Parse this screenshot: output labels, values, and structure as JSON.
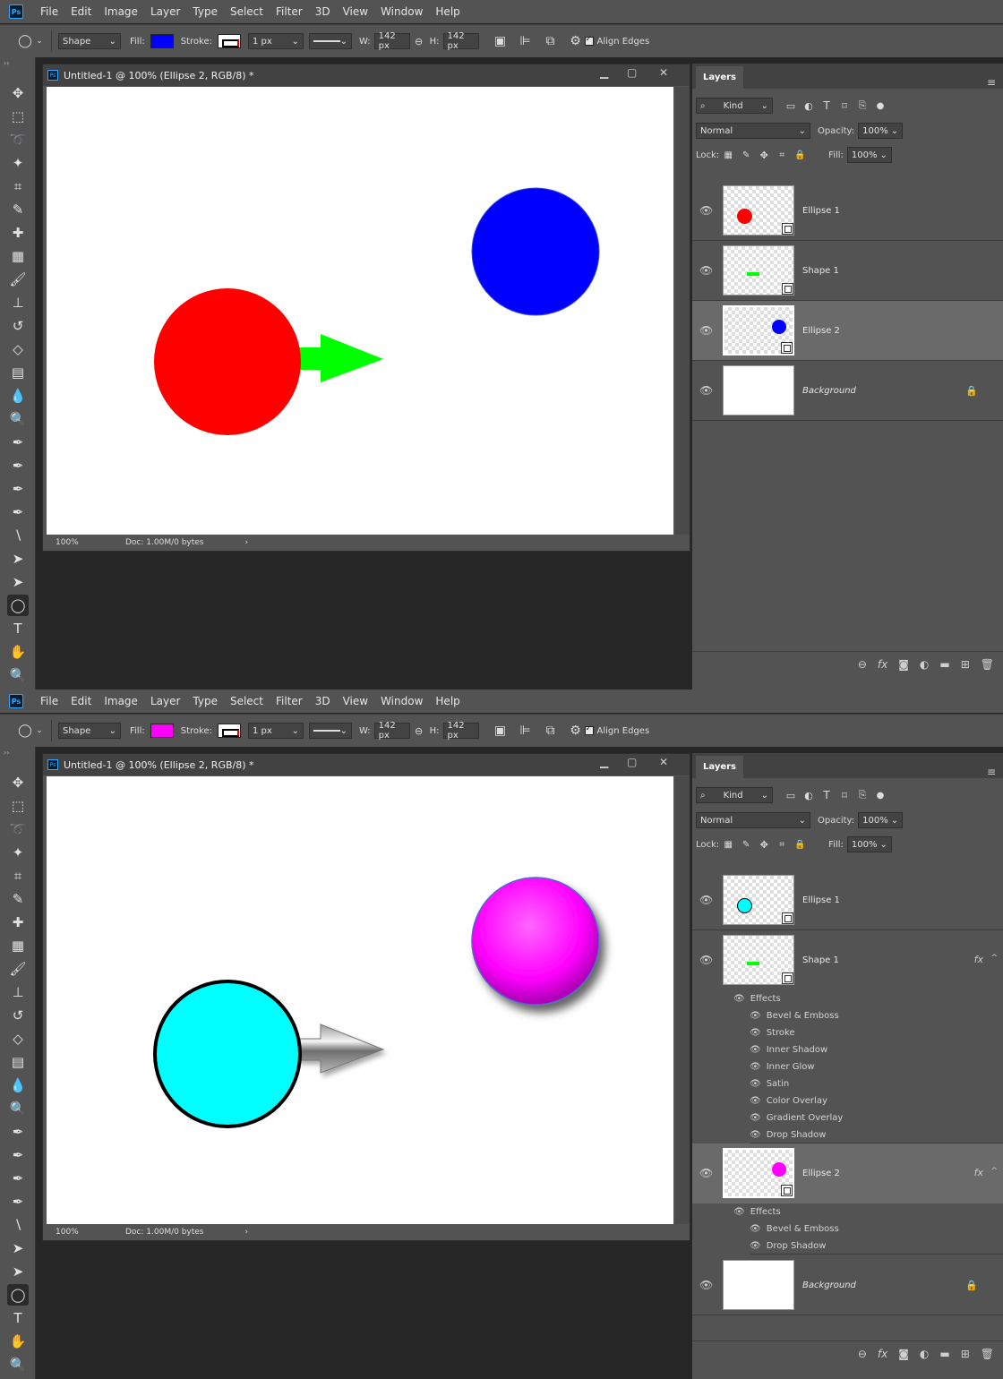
{
  "menu": [
    "File",
    "Edit",
    "Image",
    "Layer",
    "Type",
    "Select",
    "Filter",
    "3D",
    "View",
    "Window",
    "Help"
  ],
  "app_icon": "Ps",
  "options": {
    "mode": "Shape",
    "fill_label": "Fill:",
    "stroke_label": "Stroke:",
    "stroke_width": "1 px",
    "w_label": "W:",
    "w_value": "142 px",
    "h_label": "H:",
    "h_value": "142 px",
    "align_edges": "Align Edges"
  },
  "document": {
    "title": "Untitled-1 @ 100% (Ellipse 2, RGB/8) *",
    "zoom": "100%",
    "doc_info": "Doc: 1.00M/0 bytes"
  },
  "layers_panel": {
    "tab": "Layers",
    "filter_kind": "Kind",
    "blend_mode": "Normal",
    "opacity_label": "Opacity:",
    "opacity": "100%",
    "lock_label": "Lock:",
    "fill_label": "Fill:",
    "fill": "100%"
  },
  "screens": [
    {
      "fill_color": "#0000ff",
      "layers": [
        {
          "name": "Ellipse 1",
          "thumb_color": "#ff0000"
        },
        {
          "name": "Shape 1"
        },
        {
          "name": "Ellipse 2",
          "thumb_color": "#0000ff",
          "selected": true
        },
        {
          "name": "Background",
          "locked": true
        }
      ]
    },
    {
      "fill_color": "#ff00ff",
      "layers": [
        {
          "name": "Ellipse 1",
          "thumb_color": "#00ffff"
        },
        {
          "name": "Shape 1",
          "fx": "fx",
          "effects_label": "Effects",
          "effects": [
            "Bevel & Emboss",
            "Stroke",
            "Inner Shadow",
            "Inner Glow",
            "Satin",
            "Color Overlay",
            "Gradient Overlay",
            "Drop Shadow"
          ]
        },
        {
          "name": "Ellipse 2",
          "thumb_color": "#ff00ff",
          "selected": true,
          "fx": "fx",
          "effects_label": "Effects",
          "effects": [
            "Bevel & Emboss",
            "Drop Shadow"
          ]
        },
        {
          "name": "Background",
          "locked": true
        }
      ]
    }
  ],
  "colors": {
    "red": "#ff0000",
    "green": "#00ff00",
    "blue": "#0000ff",
    "cyan": "#00ffff",
    "magenta": "#ff00ff"
  }
}
